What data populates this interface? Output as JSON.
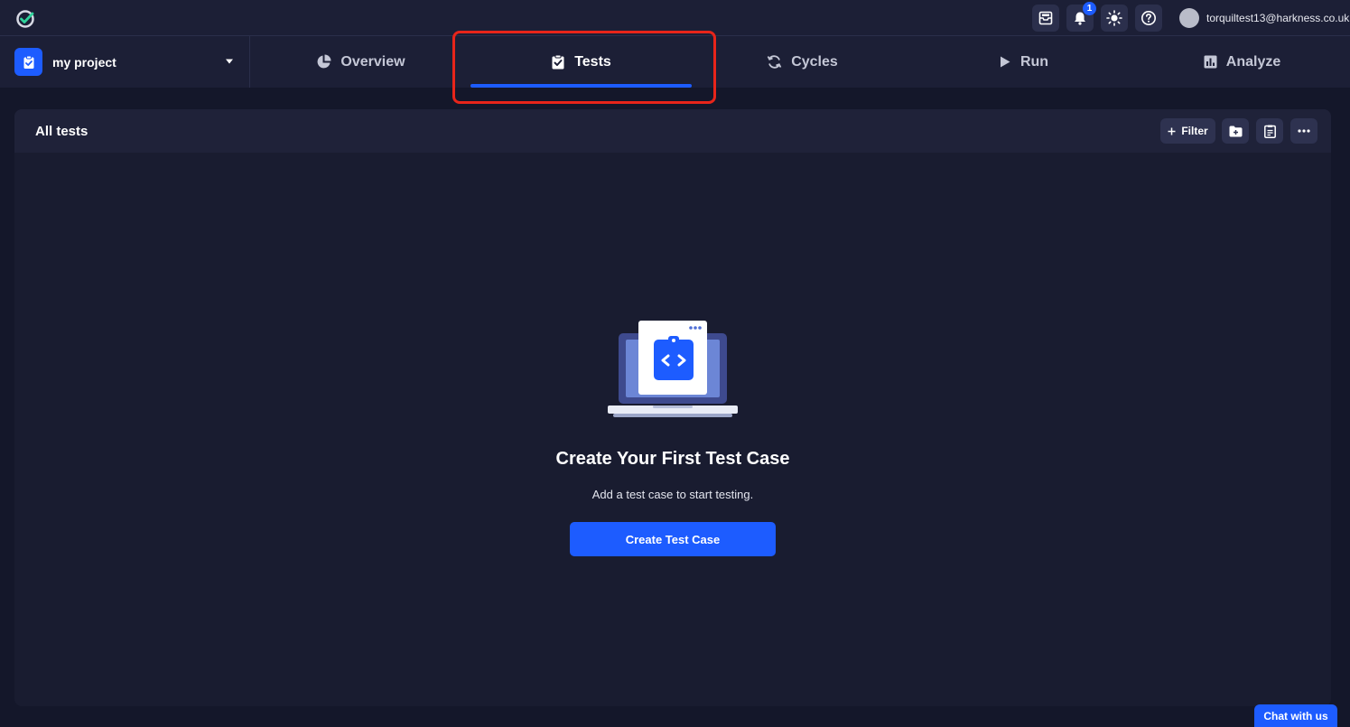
{
  "topbar": {
    "notification_count": "1",
    "user_email": "torquiltest13@harkness.co.uk",
    "icons": [
      "app-logo-icon",
      "inbox-icon",
      "bell-icon",
      "theme-sun-icon",
      "help-icon"
    ]
  },
  "project": {
    "name": "my project"
  },
  "nav": {
    "tabs": [
      {
        "label": "Overview",
        "icon": "pie-chart-icon",
        "active": false
      },
      {
        "label": "Tests",
        "icon": "clipboard-check-icon",
        "active": true
      },
      {
        "label": "Cycles",
        "icon": "cycle-icon",
        "active": false
      },
      {
        "label": "Run",
        "icon": "play-icon",
        "active": false
      },
      {
        "label": "Analyze",
        "icon": "bar-chart-icon",
        "active": false
      }
    ]
  },
  "panel": {
    "title": "All tests",
    "filter_label": "Filter"
  },
  "empty_state": {
    "title": "Create Your First Test Case",
    "subtitle": "Add a test case to start testing.",
    "button_label": "Create Test Case"
  },
  "chat": {
    "label": "Chat with us"
  },
  "colors": {
    "accent": "#1d5cff",
    "background": "#14172a",
    "highlight": "#e8251a"
  }
}
